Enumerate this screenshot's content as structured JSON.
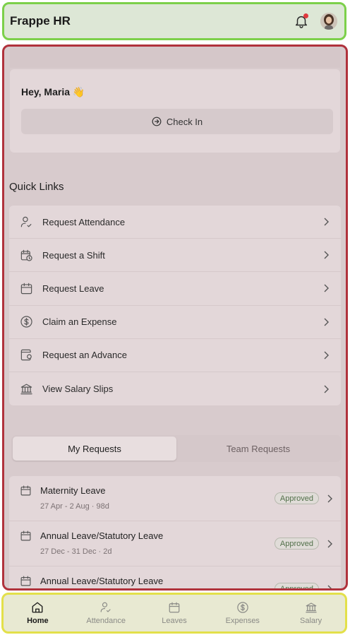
{
  "header": {
    "app_title": "Frappe HR",
    "notification_icon": "bell-icon",
    "notification_dot_color": "#e0393e"
  },
  "greeting": {
    "text": "Hey, Maria 👋",
    "checkin_label": "Check In",
    "checkin_icon": "arrow-right-circle-icon"
  },
  "quick_links": {
    "title": "Quick Links",
    "items": [
      {
        "label": "Request Attendance",
        "icon": "user-check-icon"
      },
      {
        "label": "Request a Shift",
        "icon": "calendar-clock-icon"
      },
      {
        "label": "Request Leave",
        "icon": "calendar-icon"
      },
      {
        "label": "Claim an Expense",
        "icon": "dollar-circle-icon"
      },
      {
        "label": "Request an Advance",
        "icon": "wallet-icon"
      },
      {
        "label": "View Salary Slips",
        "icon": "bank-icon"
      }
    ]
  },
  "requests": {
    "tabs": [
      {
        "label": "My Requests",
        "active": true
      },
      {
        "label": "Team Requests",
        "active": false
      }
    ],
    "items": [
      {
        "title": "Maternity Leave",
        "subtitle": "27 Apr - 2 Aug · 98d",
        "status": "Approved"
      },
      {
        "title": "Annual Leave/Statutory Leave",
        "subtitle": "27 Dec - 31 Dec · 2d",
        "status": "Approved"
      },
      {
        "title": "Annual Leave/Statutory Leave",
        "subtitle": "",
        "status": "Approved"
      }
    ]
  },
  "bottom_nav": {
    "items": [
      {
        "label": "Home",
        "icon": "home-icon",
        "active": true
      },
      {
        "label": "Attendance",
        "icon": "user-check-icon",
        "active": false
      },
      {
        "label": "Leaves",
        "icon": "calendar-icon",
        "active": false
      },
      {
        "label": "Expenses",
        "icon": "dollar-circle-icon",
        "active": false
      },
      {
        "label": "Salary",
        "icon": "bank-icon",
        "active": false
      }
    ]
  },
  "colors": {
    "header_bg": "#dde7d6",
    "main_bg": "#d8cbcd",
    "nav_bg": "#e8e9d2",
    "approved_text": "#52704a"
  }
}
